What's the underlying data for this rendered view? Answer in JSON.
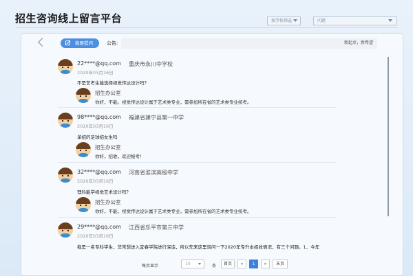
{
  "header": {
    "title": "招生咨询线上留言平台",
    "select_left": "按学校筛选",
    "select_right": "问题"
  },
  "toolbar": {
    "ask_label": "我要提问",
    "notice_label": "公告:",
    "notice_text": "新起点，新希望"
  },
  "posts": [
    {
      "email": "22****@qq.com",
      "school": "重庆市永川中学校",
      "date": "2020年03月16日",
      "question": "不是艺考生能选择视觉传达设计吗？",
      "reply_name": "招生办公室",
      "reply_text": "你好，不能。视觉传达设计属于艺术类专业，需参加所在省的艺术类专业统考。"
    },
    {
      "email": "98****@qq.com",
      "school": "福建省建宁县第一中学",
      "date": "2020年03月16日",
      "question": "单招的足球招女生吗",
      "reply_name": "招生办公室",
      "reply_text": "你好，招收，欢迎报考！"
    },
    {
      "email": "32****@qq.com",
      "school": "河南省淮滨高级中学",
      "date": "2020年03月16日",
      "question": "理科能学视觉艺术设计吗？",
      "reply_name": "招生办公室",
      "reply_text": "你好，不能，视觉传达设计属于艺术类专业，需参加所在省的艺术类专业统考。"
    },
    {
      "email": "29****@qq.com",
      "school": "江西省乐平市第三中学",
      "date": "2020年03月16日",
      "question": "我是一名专科学生，非常想进入宜春学院进行深造，所以先来这里询问一下2020年专升本招收情况，有三个问题。1、今年"
    }
  ],
  "pager": {
    "per_page_label": "每页显示",
    "per_page_value": "10",
    "unit_label": "条",
    "first_label": "首页",
    "prev_label": "«",
    "current_page": "1",
    "next_label": "»",
    "last_label": "末页"
  },
  "colors": {
    "accent": "#4a8fe0",
    "active_page": "#3d82d8",
    "background": "#e9f2fb"
  }
}
